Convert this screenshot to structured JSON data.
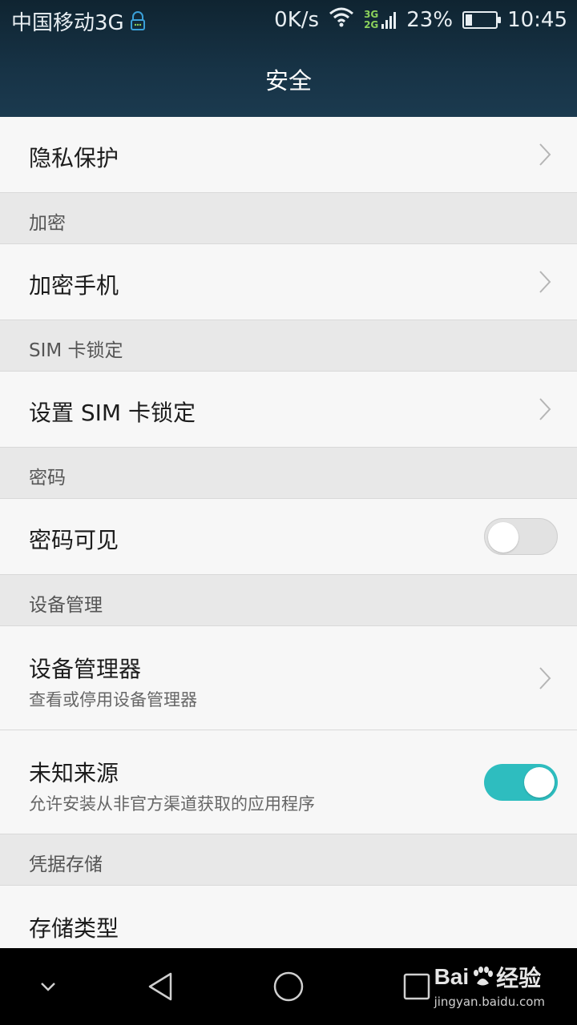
{
  "status_bar": {
    "carrier": "中国移动3G",
    "speed": "0K/s",
    "net_top": "3G",
    "net_bottom": "2G",
    "battery": "23%",
    "battery_level": 0.23,
    "time": "10:45"
  },
  "header": {
    "title": "安全"
  },
  "rows": {
    "privacy": {
      "label": "隐私保护"
    },
    "encrypt_section": "加密",
    "encrypt_phone": {
      "label": "加密手机"
    },
    "sim_section": "SIM 卡锁定",
    "sim_lock": {
      "label": "设置 SIM 卡锁定"
    },
    "password_section": "密码",
    "password_visible": {
      "label": "密码可见",
      "enabled": false
    },
    "device_section": "设备管理",
    "device_admin": {
      "label": "设备管理器",
      "sub": "查看或停用设备管理器"
    },
    "unknown_sources": {
      "label": "未知来源",
      "sub": "允许安装从非官方渠道获取的应用程序",
      "enabled": true
    },
    "credential_section": "凭据存储",
    "storage_type": {
      "label": "存储类型"
    }
  },
  "colors": {
    "accent": "#2ebdbf",
    "header_bg": "#173346"
  },
  "watermark": {
    "logo_left": "Bai",
    "logo_right": "经验",
    "url": "jingyan.baidu.com"
  }
}
